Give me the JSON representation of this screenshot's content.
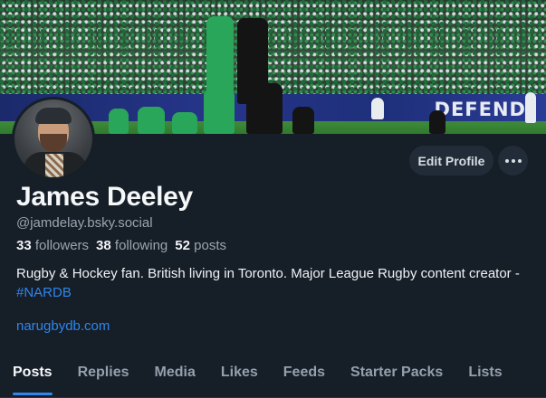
{
  "banner": {
    "ad_text": "DEFEND"
  },
  "profile": {
    "display_name": "James Deeley",
    "handle": "@jamdelay.bsky.social",
    "stats": {
      "followers_count": "33",
      "followers_label": "followers",
      "following_count": "38",
      "following_label": "following",
      "posts_count": "52",
      "posts_label": "posts"
    },
    "bio_text": "Rugby & Hockey fan. British living in Toronto. Major League Rugby content creator - ",
    "bio_hashtag": "#NARDB",
    "website": "narugbydb.com"
  },
  "actions": {
    "edit_profile_label": "Edit Profile",
    "more_icon": "ellipsis-icon"
  },
  "tabs": [
    {
      "label": "Posts",
      "active": true
    },
    {
      "label": "Replies",
      "active": false
    },
    {
      "label": "Media",
      "active": false
    },
    {
      "label": "Likes",
      "active": false
    },
    {
      "label": "Feeds",
      "active": false
    },
    {
      "label": "Starter Packs",
      "active": false
    },
    {
      "label": "Lists",
      "active": false
    }
  ],
  "colors": {
    "background": "#161e27",
    "accent": "#2f86ee",
    "muted_text": "#9aa5b1"
  }
}
